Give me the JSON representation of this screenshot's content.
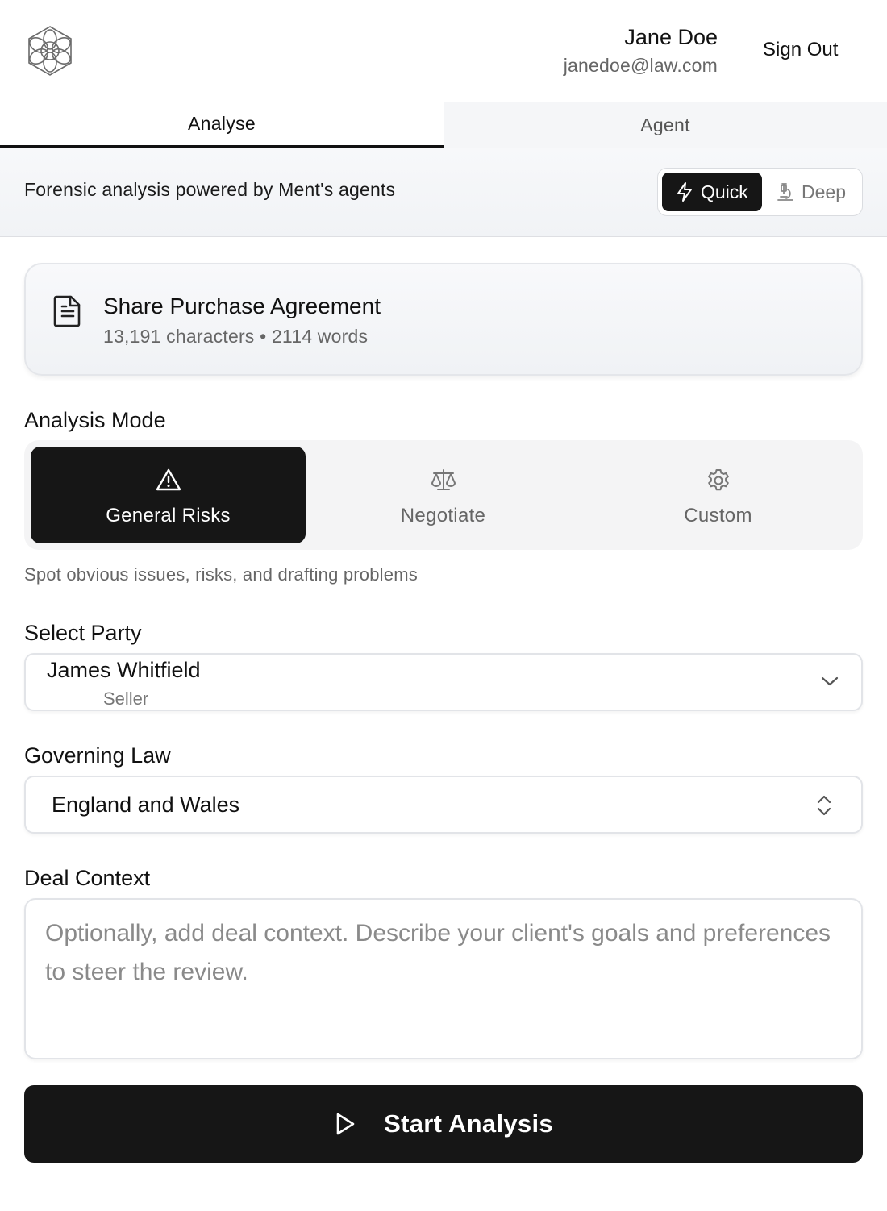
{
  "header": {
    "user_name": "Jane Doe",
    "user_email": "janedoe@law.com",
    "sign_out_label": "Sign Out"
  },
  "tabs": [
    {
      "label": "Analyse",
      "active": true
    },
    {
      "label": "Agent",
      "active": false
    }
  ],
  "band": {
    "tagline": "Forensic analysis powered by Ment's agents",
    "speed_options": [
      {
        "label": "Quick",
        "icon": "lightning-icon",
        "selected": true
      },
      {
        "label": "Deep",
        "icon": "microscope-icon",
        "selected": false
      }
    ]
  },
  "document": {
    "title": "Share Purchase Agreement",
    "meta": "13,191 characters • 2114 words",
    "icon": "document-icon"
  },
  "analysis_mode": {
    "label": "Analysis Mode",
    "options": [
      {
        "label": "General Risks",
        "icon": "warning-triangle-icon",
        "selected": true
      },
      {
        "label": "Negotiate",
        "icon": "scales-icon",
        "selected": false
      },
      {
        "label": "Custom",
        "icon": "gear-icon",
        "selected": false
      }
    ],
    "description": "Spot obvious issues, risks, and drafting problems"
  },
  "party": {
    "label": "Select Party",
    "selected_name": "James Whitfield",
    "selected_role": "Seller"
  },
  "governing_law": {
    "label": "Governing Law",
    "selected": "England and Wales"
  },
  "deal_context": {
    "label": "Deal Context",
    "value": "",
    "placeholder": "Optionally, add deal context. Describe your client's goals and preferences to steer the review."
  },
  "start_button": {
    "label": "Start Analysis",
    "icon": "play-icon"
  },
  "colors": {
    "primary": "#161616",
    "muted_text": "#666666",
    "border": "#e2e4e8",
    "band_bg": "#f4f6f8"
  }
}
